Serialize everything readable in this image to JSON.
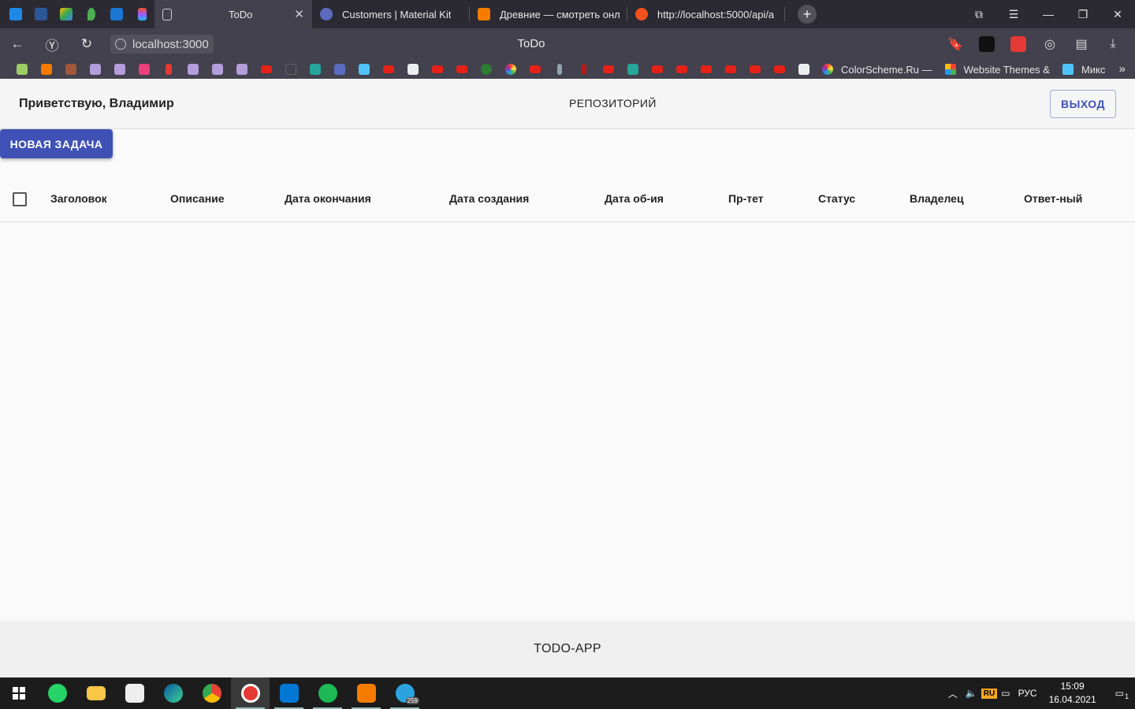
{
  "browser": {
    "tabs": [
      {
        "title": "ToDo",
        "active": true,
        "favicon_color": "#cfcfd6"
      },
      {
        "title": "Customers | Material Kit",
        "active": false,
        "favicon_color": "#5c6bc0"
      },
      {
        "title": "Древние — смотреть онл",
        "active": false,
        "favicon_color": "#f57c00"
      },
      {
        "title": "http://localhost:5000/api/a",
        "active": false,
        "favicon_color": "#f4511e"
      }
    ],
    "close_glyph": "✕",
    "new_tab_glyph": "+",
    "address": "localhost:3000",
    "page_title": "ToDo",
    "bookmarks": {
      "colorscheme": "ColorScheme.Ru —",
      "website_themes": "Website Themes &",
      "misc": "Микс"
    }
  },
  "app": {
    "greeting": "Приветствую, Владимир",
    "repo_link": "РЕПОЗИТОРИЙ",
    "logout": "ВЫХОД",
    "new_task": "НОВАЯ ЗАДАЧА",
    "columns": [
      "Заголовок",
      "Описание",
      "Дата окончания",
      "Дата создания",
      "Дата об-ия",
      "Пр-тет",
      "Статус",
      "Владелец",
      "Ответ-ный"
    ],
    "footer": "TODO-APP",
    "accent": "#3f51b5"
  },
  "taskbar": {
    "language": "РУС",
    "lang_badge": "RU",
    "time": "15:09",
    "date": "16.04.2021",
    "telegram_badge": "259",
    "notification_count": "1"
  }
}
